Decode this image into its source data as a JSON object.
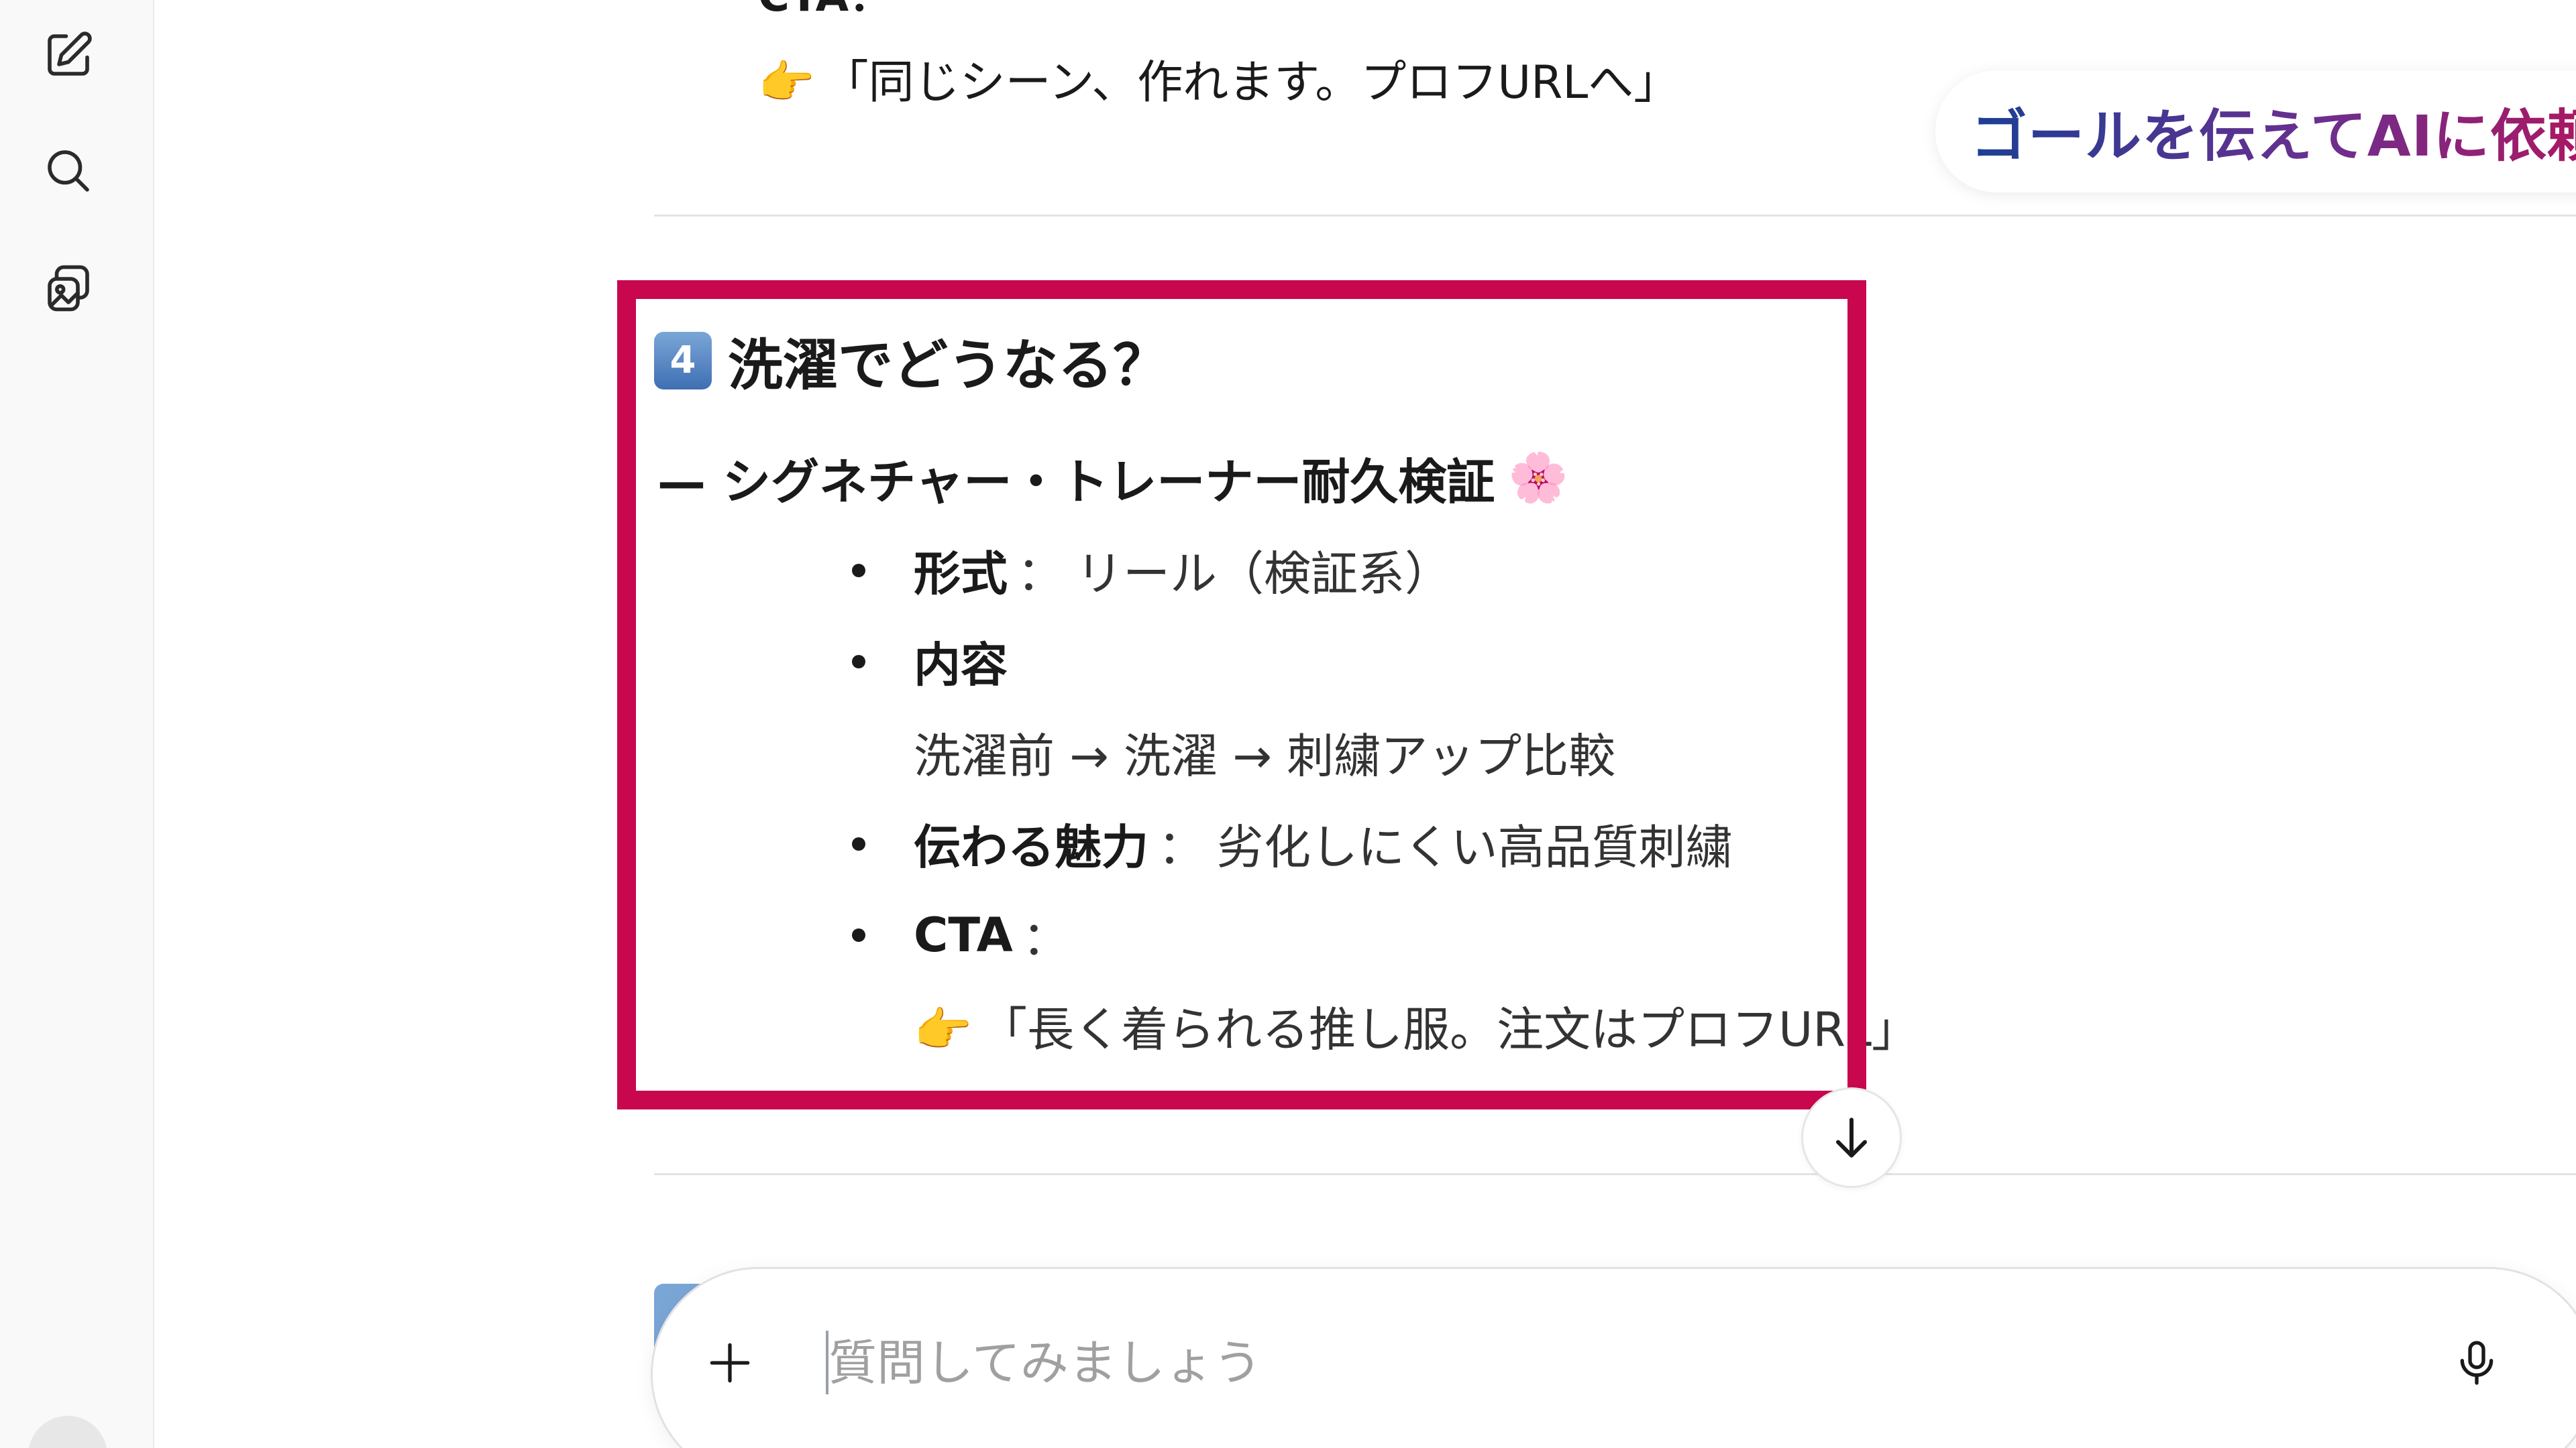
{
  "sidebar": {
    "icons": [
      "new-chat-icon",
      "search-icon",
      "images-icon"
    ]
  },
  "badge": {
    "text": "ゴールを伝えてAIに依頼"
  },
  "previous": {
    "cta_label": "CTA：",
    "quote_emoji": "👉",
    "quote": "「同じシーン、作れます。プロフURLへ」"
  },
  "section": {
    "number": "4",
    "title": "洗濯でどうなる？",
    "subtitle": "— シグネチャー・トレーナー耐久検証",
    "subtitle_emoji": "🌸",
    "items": [
      {
        "key": "形式",
        "colon": "：",
        "value": "リール（検証系）"
      },
      {
        "key": "内容",
        "colon": "",
        "value": ""
      },
      {
        "key": "伝わる魅力",
        "colon": "：",
        "value": "劣化しにくい高品質刺繍"
      },
      {
        "key": "CTA",
        "colon": "：",
        "value": ""
      }
    ],
    "content_line": "洗濯前 → 洗濯 → 刺繍アップ比較",
    "cta_emoji": "👉",
    "cta_quote": "「長く着られる推し服。注文はプロフURL」"
  },
  "composer": {
    "placeholder": "質問してみましょう",
    "value": ""
  },
  "colors": {
    "highlight_border": "#c8074f",
    "badge_gradient_start": "#1c3f95",
    "badge_gradient_end": "#b0155f"
  }
}
